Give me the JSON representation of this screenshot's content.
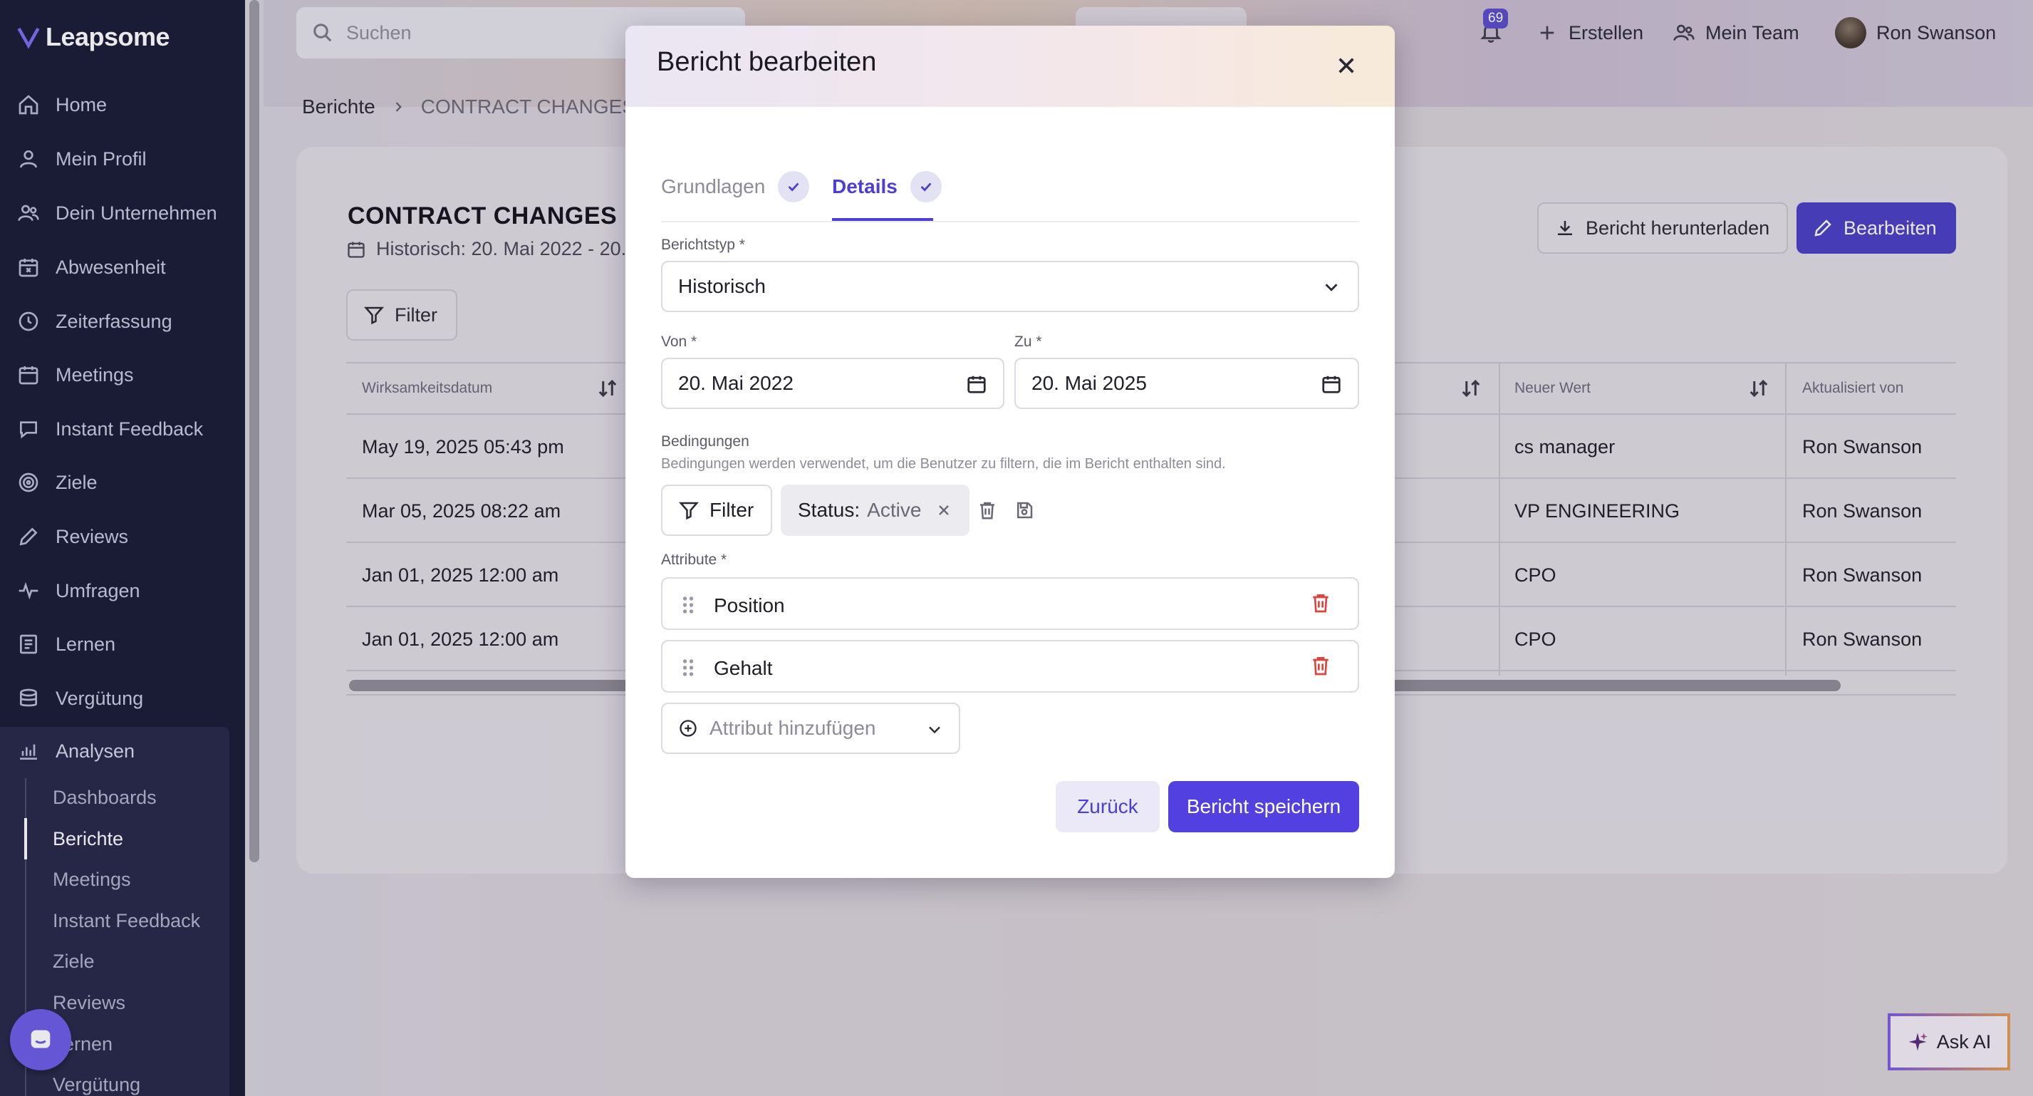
{
  "app": {
    "logo_text": "Leapsome"
  },
  "sidebar": {
    "items": [
      {
        "label": "Home",
        "icon": "home-icon"
      },
      {
        "label": "Mein Profil",
        "icon": "user-icon"
      },
      {
        "label": "Dein Unternehmen",
        "icon": "users-icon"
      },
      {
        "label": "Abwesenheit",
        "icon": "calendar-x-icon"
      },
      {
        "label": "Zeiterfassung",
        "icon": "clock-icon"
      },
      {
        "label": "Meetings",
        "icon": "calendar-icon"
      },
      {
        "label": "Instant Feedback",
        "icon": "chat-icon"
      },
      {
        "label": "Ziele",
        "icon": "target-icon"
      },
      {
        "label": "Reviews",
        "icon": "pencil-icon"
      },
      {
        "label": "Umfragen",
        "icon": "pulse-icon"
      },
      {
        "label": "Lernen",
        "icon": "book-icon"
      },
      {
        "label": "Vergütung",
        "icon": "coins-icon"
      },
      {
        "label": "Analysen",
        "icon": "chart-icon"
      }
    ],
    "sub_items": [
      {
        "label": "Dashboards"
      },
      {
        "label": "Berichte"
      },
      {
        "label": "Meetings"
      },
      {
        "label": "Instant Feedback"
      },
      {
        "label": "Ziele"
      },
      {
        "label": "Reviews"
      },
      {
        "label": "Lernen"
      },
      {
        "label": "Vergütung"
      }
    ]
  },
  "topbar": {
    "search_placeholder": "Suchen",
    "notification_count": "69",
    "create_label": "Erstellen",
    "team_label": "Mein Team",
    "user_name": "Ron Swanson"
  },
  "breadcrumb": {
    "parent": "Berichte",
    "current": "CONTRACT CHANGES"
  },
  "report": {
    "title": "CONTRACT CHANGES",
    "subtitle": "Historisch: 20. Mai 2022 - 20.",
    "download_label": "Bericht herunterladen",
    "edit_label": "Bearbeiten",
    "filter_label": "Filter",
    "columns": {
      "date": "Wirksamkeitsdatum",
      "new_value": "Neuer Wert",
      "updated_by": "Aktualisiert von"
    },
    "rows": [
      {
        "date": "May 19, 2025 05:43 pm",
        "new_value": "cs manager",
        "updated_by": "Ron Swanson"
      },
      {
        "date": "Mar 05, 2025 08:22 am",
        "new_value": "VP ENGINEERING",
        "updated_by": "Ron Swanson"
      },
      {
        "date": "Jan 01, 2025 12:00 am",
        "new_value": "CPO",
        "updated_by": "Ron Swanson"
      },
      {
        "date": "Jan 01, 2025 12:00 am",
        "new_value": "CPO",
        "updated_by": "Ron Swanson"
      }
    ]
  },
  "ask_ai_label": "Ask AI",
  "modal": {
    "title": "Bericht bearbeiten",
    "tabs": [
      {
        "label": "Grundlagen"
      },
      {
        "label": "Details"
      }
    ],
    "report_type_label": "Berichtstyp *",
    "report_type_value": "Historisch",
    "from_label": "Von *",
    "from_value": "20. Mai 2022",
    "to_label": "Zu *",
    "to_value": "20. Mai 2025",
    "conditions_label": "Bedingungen",
    "conditions_help": "Bedingungen werden verwendet, um die Benutzer zu filtern, die im Bericht enthalten sind.",
    "filter_label": "Filter",
    "status_key": "Status:",
    "status_value": "Active",
    "attributes_label": "Attribute *",
    "attributes": [
      {
        "name": "Position"
      },
      {
        "name": "Gehalt"
      }
    ],
    "add_attribute_placeholder": "Attribut hinzufügen",
    "back_label": "Zurück",
    "save_label": "Bericht speichern"
  },
  "colors": {
    "primary": "#5241e0",
    "sidebar_bg": "#191b35",
    "danger": "#d9453f"
  }
}
